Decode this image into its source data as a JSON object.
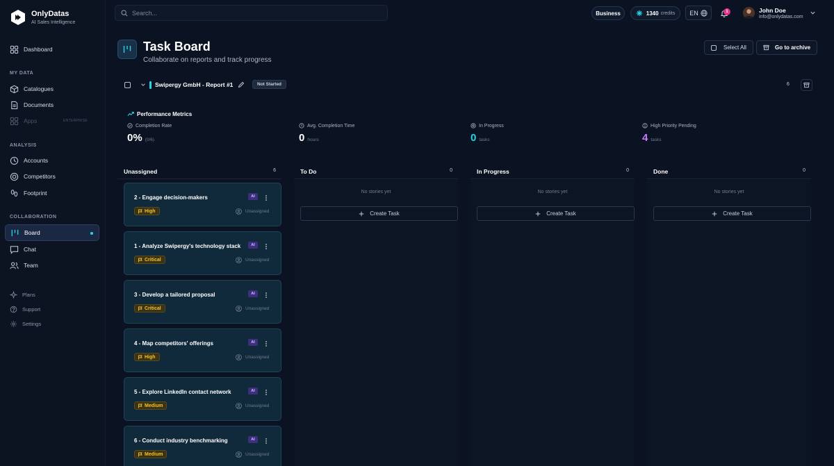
{
  "brand": {
    "name": "OnlyDatas",
    "tagline": "AI Sales Intelligence"
  },
  "sidebar": {
    "dashboard": "Dashboard",
    "sections": {
      "my_data": "MY DATA",
      "analysis": "ANALYSIS",
      "collaboration": "COLLABORATION"
    },
    "my_data_items": {
      "catalogues": "Catalogues",
      "documents": "Documents",
      "apps": "Apps",
      "apps_badge": "ENTERPRISE"
    },
    "analysis_items": {
      "accounts": "Accounts",
      "competitors": "Competitors",
      "footprint": "Footprint"
    },
    "collab_items": {
      "board": "Board",
      "chat": "Chat",
      "team": "Team"
    },
    "footer_items": {
      "plans": "Plans",
      "support": "Support",
      "settings": "Settings"
    }
  },
  "topbar": {
    "search_placeholder": "Search...",
    "plan": "Business",
    "credits_value": "1340",
    "credits_label": "credits",
    "language": "EN",
    "notifications": "1",
    "user_name": "John Doe",
    "user_email": "info@onlydatas.com"
  },
  "header": {
    "title": "Task Board",
    "subtitle": "Collaborate on reports and track progress",
    "select_all": "Select All",
    "archive": "Go to archive"
  },
  "report": {
    "name": "Swipergy GmbH - Report #1",
    "status": "Not Started",
    "count": "6"
  },
  "metrics": {
    "title": "Performance Metrics",
    "completion_rate": {
      "label": "Completion Rate",
      "value": "0%",
      "unit": "(0/6)"
    },
    "avg_time": {
      "label": "Avg. Completion Time",
      "value": "0",
      "unit": "hours"
    },
    "in_progress": {
      "label": "In Progress",
      "value": "0",
      "unit": "tasks"
    },
    "high_priority": {
      "label": "High Priority Pending",
      "value": "4",
      "unit": "tasks"
    }
  },
  "colors": {
    "accent": "#2ad4e6",
    "purple": "#c57bff",
    "priority_bg": "#3b3317",
    "priority_text": "#f2c230"
  },
  "columns": {
    "unassigned": {
      "name": "Unassigned",
      "count": "6"
    },
    "todo": {
      "name": "To Do",
      "count": "0",
      "empty": "No stories yet",
      "create": "Create Task"
    },
    "in_progress": {
      "name": "In Progress",
      "count": "0",
      "empty": "No stories yet",
      "create": "Create Task"
    },
    "done": {
      "name": "Done",
      "count": "0",
      "empty": "No stories yet",
      "create": "Create Task"
    }
  },
  "tasks": [
    {
      "title": "2 - Engage decision-makers",
      "ai": "AI",
      "priority": "High",
      "assignee": "Unassigned"
    },
    {
      "title": "1 - Analyze Swipergy's technology stack",
      "ai": "AI",
      "priority": "Critical",
      "assignee": "Unassigned"
    },
    {
      "title": "3 - Develop a tailored proposal",
      "ai": "AI",
      "priority": "Critical",
      "assignee": "Unassigned"
    },
    {
      "title": "4 - Map competitors' offerings",
      "ai": "AI",
      "priority": "High",
      "assignee": "Unassigned"
    },
    {
      "title": "5 - Explore LinkedIn contact network",
      "ai": "AI",
      "priority": "Medium",
      "assignee": "Unassigned"
    },
    {
      "title": "6 - Conduct industry benchmarking",
      "ai": "AI",
      "priority": "Medium",
      "assignee": "Unassigned"
    }
  ]
}
